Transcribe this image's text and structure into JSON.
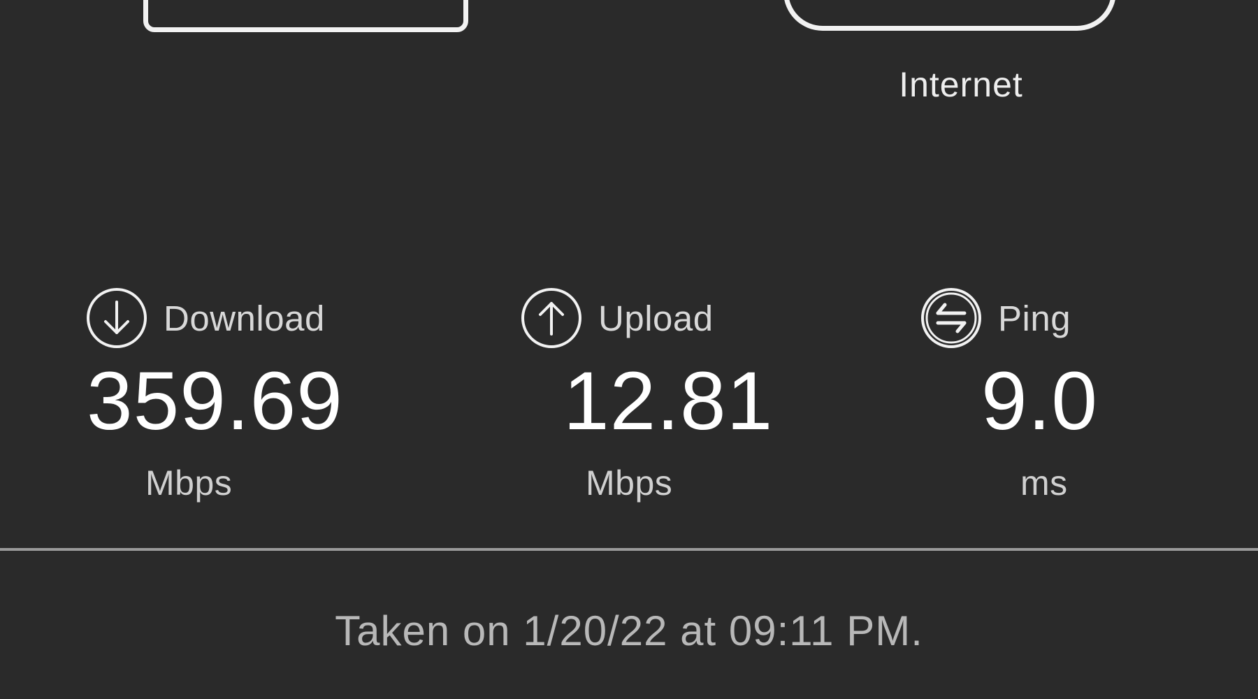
{
  "connection": {
    "internet_label": "Internet"
  },
  "results": {
    "download": {
      "label": "Download",
      "value": "359.69",
      "unit": "Mbps",
      "icon": "arrow-down-circle-icon"
    },
    "upload": {
      "label": "Upload",
      "value": "12.81",
      "unit": "Mbps",
      "icon": "arrow-up-circle-icon"
    },
    "ping": {
      "label": "Ping",
      "value": "9.0",
      "unit": "ms",
      "icon": "swap-arrows-circle-icon"
    }
  },
  "footer": {
    "timestamp": "Taken on 1/20/22 at 09:11 PM."
  },
  "colors": {
    "background": "#2a2a2a",
    "text": "#ffffff",
    "muted_text": "#b8b8b8",
    "divider": "#9a9a9a"
  }
}
